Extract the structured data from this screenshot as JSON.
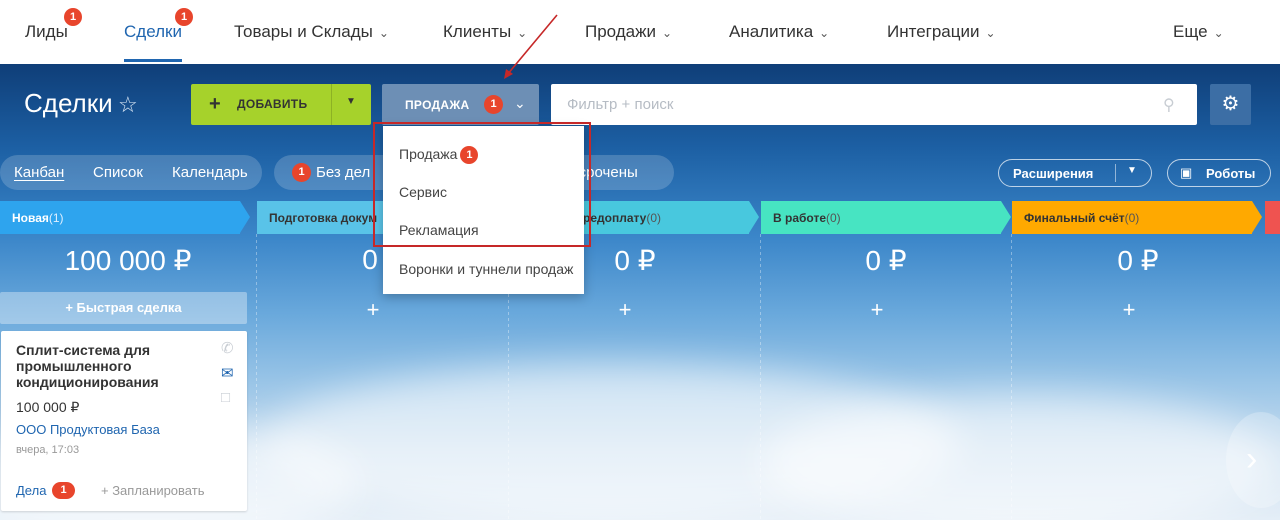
{
  "topnav": {
    "items": [
      {
        "label": "Лиды",
        "badge": "1",
        "chevron": false
      },
      {
        "label": "Сделки",
        "badge": "1",
        "chevron": false,
        "active": true
      },
      {
        "label": "Товары и Склады",
        "chevron": true
      },
      {
        "label": "Клиенты",
        "chevron": true
      },
      {
        "label": "Продажи",
        "chevron": true
      },
      {
        "label": "Аналитика",
        "chevron": true
      },
      {
        "label": "Интеграции",
        "chevron": true
      },
      {
        "label": "Еще",
        "chevron": true
      }
    ],
    "active_color": "#2066b0"
  },
  "toolbar": {
    "title": "Сделки",
    "add_label": "ДОБАВИТЬ",
    "funnel_label": "ПРОДАЖА",
    "funnel_badge": "1",
    "search_placeholder": "Фильтр + поиск"
  },
  "views": {
    "items": [
      "Канбан",
      "Список",
      "Календарь"
    ],
    "active": "Канбан"
  },
  "counters": {
    "badge": "1",
    "label": "Без дел",
    "label2": "росрочены"
  },
  "extensions_label": "Расширения",
  "robots_label": "Роботы",
  "stages": [
    {
      "name": "Новая",
      "count": "(1)",
      "color": "#2ea4ee",
      "sum": "100 000 ₽"
    },
    {
      "name": "Подготовка докум",
      "count": "",
      "color": "#59c3e8",
      "sum": "0"
    },
    {
      "name": "редоплату",
      "count": "(0)",
      "color": "#48c8de",
      "sum": "0 ₽"
    },
    {
      "name": "В работе",
      "count": "(0)",
      "color": "#47e4c2",
      "sum": "0 ₽"
    },
    {
      "name": "Финальный счёт",
      "count": "(0)",
      "color": "#ffa900",
      "sum": "0 ₽"
    }
  ],
  "quick_deal_label": "+ Быстрая сделка",
  "card": {
    "title": "Сплит-система для промышленного кондиционирования",
    "amount": "100 000 ₽",
    "company": "ООО Продуктовая База",
    "date": "вчера, 17:03",
    "deals_label": "Дела",
    "deals_badge": "1",
    "plan_label": "+ Запланировать"
  },
  "dropdown": {
    "items": [
      {
        "label": "Продажа",
        "badge": "1"
      },
      {
        "label": "Сервис"
      },
      {
        "label": "Рекламация"
      },
      {
        "label": "Воронки и туннели продаж"
      }
    ]
  },
  "colors": {
    "add_button": "#a6d22b",
    "funnel_button": "#6d8fb5",
    "badge": "#e8452c",
    "highlight": "#c62828"
  }
}
